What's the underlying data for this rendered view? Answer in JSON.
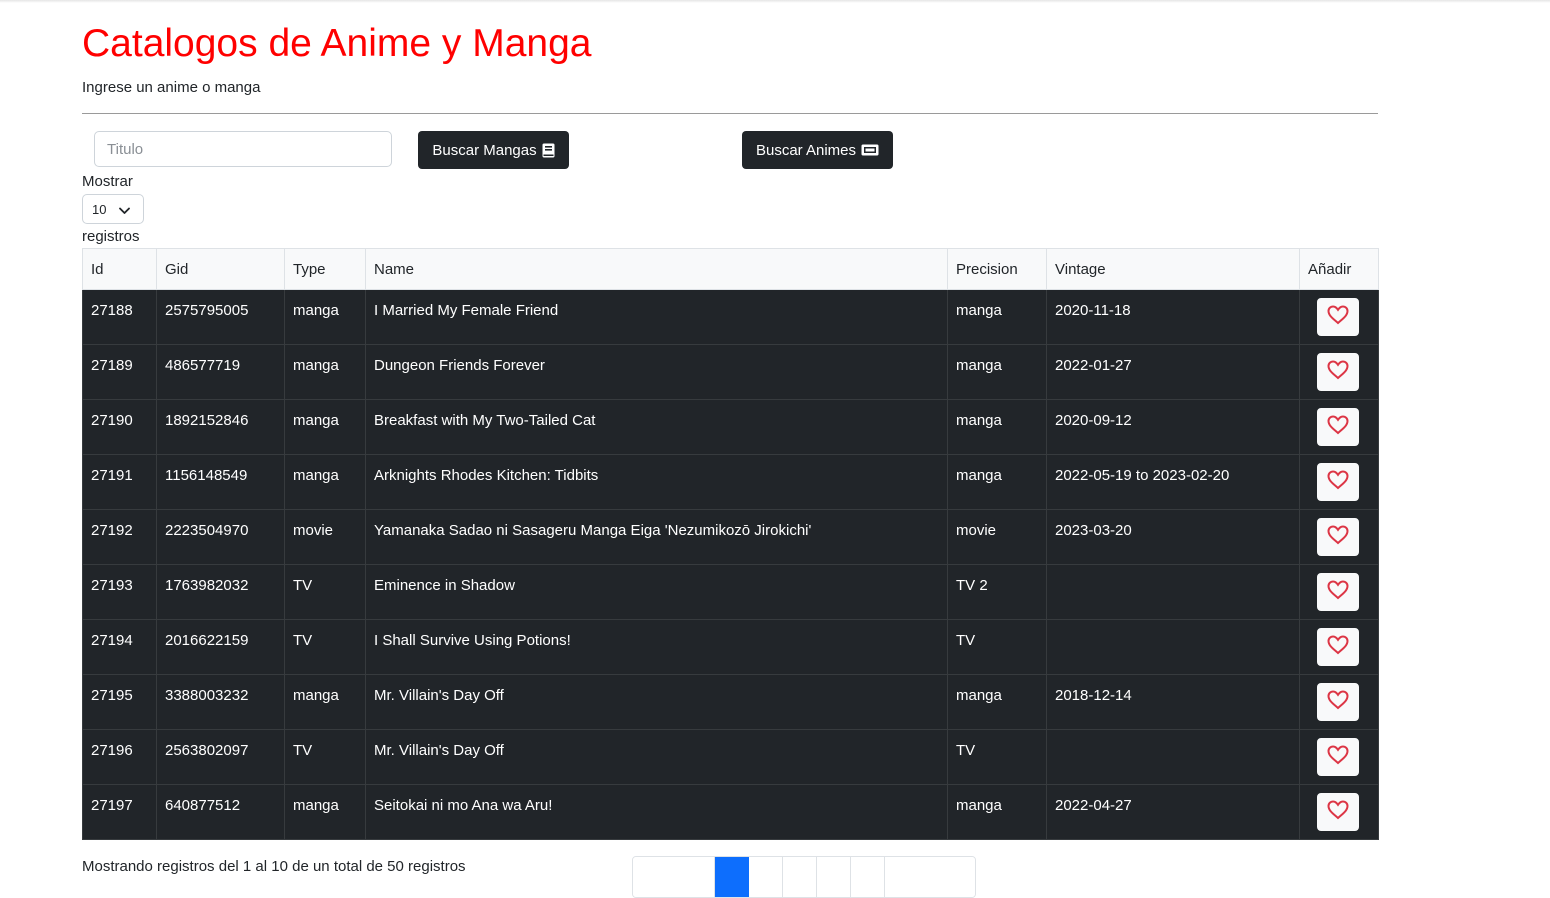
{
  "header": {
    "title": "Catalogos de Anime y Manga",
    "subtitle": "Ingrese un anime o manga"
  },
  "search": {
    "placeholder": "Titulo",
    "value": "",
    "buttons": {
      "mangas": "Buscar Mangas",
      "animes": "Buscar Animes"
    }
  },
  "page_size": {
    "label_before": "Mostrar",
    "selected": "10",
    "label_after": "registros"
  },
  "table": {
    "columns": [
      "Id",
      "Gid",
      "Type",
      "Name",
      "Precision",
      "Vintage",
      "Añadir"
    ],
    "rows": [
      {
        "id": "27188",
        "gid": "2575795005",
        "type": "manga",
        "name": "I Married My Female Friend",
        "precision": "manga",
        "vintage": "2020-11-18"
      },
      {
        "id": "27189",
        "gid": "486577719",
        "type": "manga",
        "name": "Dungeon Friends Forever",
        "precision": "manga",
        "vintage": "2022-01-27"
      },
      {
        "id": "27190",
        "gid": "1892152846",
        "type": "manga",
        "name": "Breakfast with My Two-Tailed Cat",
        "precision": "manga",
        "vintage": "2020-09-12"
      },
      {
        "id": "27191",
        "gid": "1156148549",
        "type": "manga",
        "name": "Arknights Rhodes Kitchen: Tidbits",
        "precision": "manga",
        "vintage": "2022-05-19 to 2023-02-20"
      },
      {
        "id": "27192",
        "gid": "2223504970",
        "type": "movie",
        "name": "Yamanaka Sadao ni Sasageru Manga Eiga 'Nezumikozō Jirokichi'",
        "precision": "movie",
        "vintage": "2023-03-20"
      },
      {
        "id": "27193",
        "gid": "1763982032",
        "type": "TV",
        "name": "Eminence in Shadow",
        "precision": "TV 2",
        "vintage": ""
      },
      {
        "id": "27194",
        "gid": "2016622159",
        "type": "TV",
        "name": "I Shall Survive Using Potions!",
        "precision": "TV",
        "vintage": ""
      },
      {
        "id": "27195",
        "gid": "3388003232",
        "type": "manga",
        "name": "Mr. Villain's Day Off",
        "precision": "manga",
        "vintage": "2018-12-14"
      },
      {
        "id": "27196",
        "gid": "2563802097",
        "type": "TV",
        "name": "Mr. Villain's Day Off",
        "precision": "TV",
        "vintage": ""
      },
      {
        "id": "27197",
        "gid": "640877512",
        "type": "manga",
        "name": "Seitokai ni mo Ana wa Aru!",
        "precision": "manga",
        "vintage": "2022-04-27"
      }
    ]
  },
  "footer": {
    "info": "Mostrando registros del 1 al 10 de un total de 50 registros"
  },
  "icons": {
    "mangas_button": "book-icon",
    "animes_button": "ticket-icon",
    "add_favorite": "heart-icon",
    "page_size": "chevron-down-icon"
  },
  "colors": {
    "title": "#ff0000",
    "dark": "#212529",
    "heart": "#dc3545",
    "pager_active": "#0d6efd"
  }
}
